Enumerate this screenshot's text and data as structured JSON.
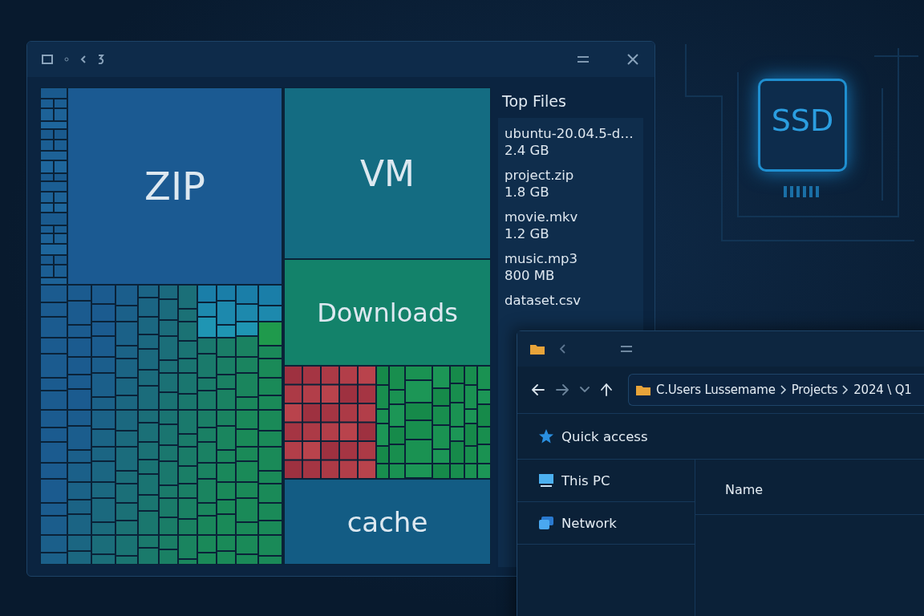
{
  "treemap_window": {
    "tiles": [
      {
        "label": "ZIP",
        "color": "#1b5a92"
      },
      {
        "label": "VM",
        "color": "#146c82"
      },
      {
        "label": "Downloads",
        "color": "#13826a"
      },
      {
        "label": "cache",
        "color": "#135c84"
      }
    ],
    "side_panel": {
      "title": "Top Files",
      "files": [
        {
          "name": "ubuntu-20.04.5-d…",
          "size": "2.4 GB"
        },
        {
          "name": "project.zip",
          "size": "1.8 GB"
        },
        {
          "name": "movie.mkv",
          "size": "1.2 GB"
        },
        {
          "name": "music.mp3",
          "size": "800 MB"
        },
        {
          "name": "dataset.csv"
        }
      ]
    }
  },
  "explorer": {
    "address": [
      "C.Users Lussemame",
      "Projects",
      "2024 \\ Q1"
    ],
    "nav": [
      {
        "label": "Quick access",
        "kind": "star"
      },
      {
        "label": "This PC",
        "kind": "pc"
      },
      {
        "label": "Network",
        "kind": "network"
      }
    ],
    "columns": [
      "Name"
    ]
  },
  "chip": {
    "label": "SSD"
  }
}
